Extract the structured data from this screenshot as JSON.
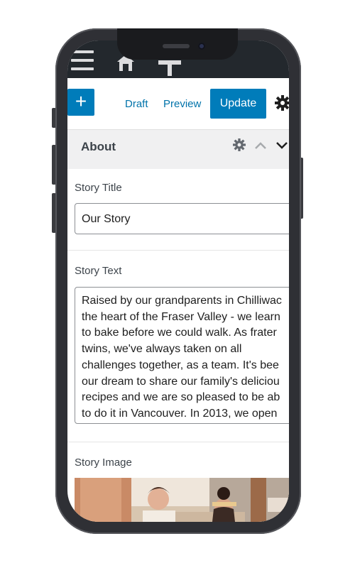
{
  "admin_bar": {
    "icons": [
      "menu-icon",
      "home-icon",
      "new-icon"
    ]
  },
  "toolbar": {
    "add_label": "+",
    "draft_label": "Draft",
    "preview_label": "Preview",
    "update_label": "Update",
    "settings_icon": "gear-icon"
  },
  "panel": {
    "title": "About",
    "icons": [
      "gear-icon",
      "chevron-up-icon",
      "chevron-down-icon"
    ]
  },
  "fields": {
    "story_title_label": "Story Title",
    "story_title_value": "Our Story",
    "story_text_label": "Story Text",
    "story_text_lines": [
      "Raised by our grandparents in Chilliwac",
      "the heart of the Fraser Valley - we learn",
      "to bake before we could walk.  As frater",
      "twins, we've always taken on all",
      "challenges together, as a team.  It's bee",
      "our dream to share our family's deliciou",
      "recipes and we are so pleased to be ab",
      "to do it in Vancouver.  In 2013, we open"
    ],
    "story_image_label": "Story Image"
  },
  "colors": {
    "admin_bar": "#23282d",
    "accent": "#007cba",
    "link": "#0073aa",
    "panel_bg": "#f0f0f1"
  }
}
